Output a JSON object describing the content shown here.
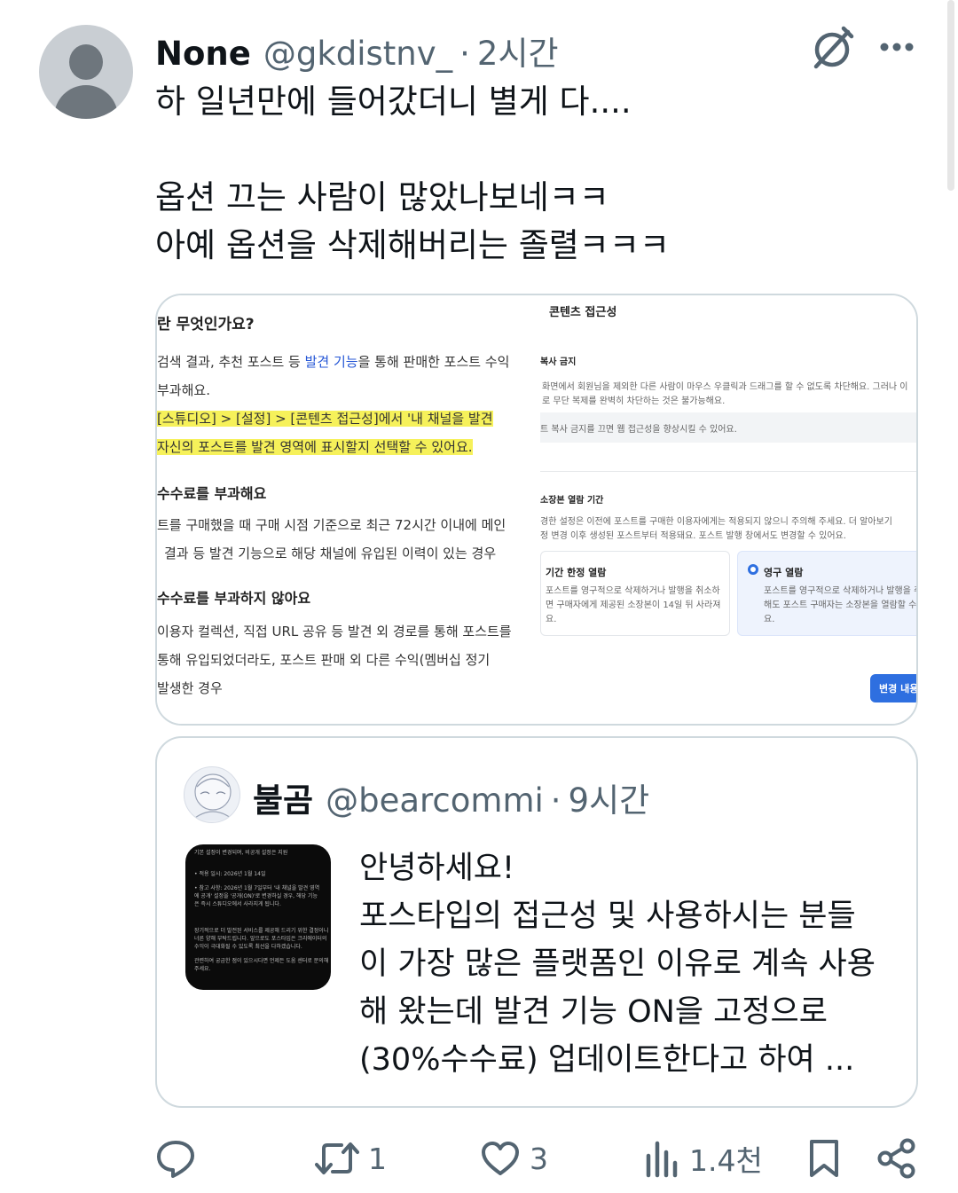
{
  "tweet": {
    "author_name": "None",
    "handle": "@gkdistnv_",
    "separator": "·",
    "time": "2시간",
    "text_lines": [
      "하 일년만에 들어갔더니 별게 다....",
      "",
      "옵션 끄는 사람이 많았나보네ㅋㅋ",
      "아예 옵션을 삭제해버리는 졸렬ㅋㅋㅋ"
    ]
  },
  "media": {
    "left_doc": {
      "heading1": "란 무엇인가요?",
      "line1_pre": "검색 결과, 추천 포스트 등 ",
      "line1_link": "발견 기능",
      "line1_post": "을 통해 판매한 포스트 수익",
      "line2": "부과해요.",
      "line3": "[스튜디오] > [설정] > [콘텐츠 접근성]에서 '내 채널을 발견",
      "line4": "자신의 포스트를 발견 영역에 표시할지 선택할 수 있어요.",
      "heading2": "수수료를 부과해요",
      "line5": "트를 구매했을 때 구매 시점 기준으로 최근 72시간 이내에 메인",
      "line6": "결과 등 발견 기능으로 해당 채널에 유입된 이력이 있는 경우",
      "heading3": "수수료를 부과하지 않아요",
      "line7": "이용자 컬렉션, 직접 URL 공유 등 발견 외 경로를 통해 포스트를",
      "line8": "통해 유입되었더라도, 포스트 판매 외 다른 수익(멤버십 정기",
      "line9": "발생한 경우"
    },
    "right_doc": {
      "title": "콘텐츠 접근성",
      "sec1_label": "복사 금지",
      "sec1_desc1": "화면에서 회원님을 제외한 다른 사람이 마우스 우클릭과 드래그를 할 수 없도록 차단해요. 그러나 이",
      "sec1_desc2": "로 무단 복제를 완벽히 차단하는 것은 불가능해요.",
      "sec1_note": "트 복사 금지를 끄면 웹 접근성을 향상시킬 수 있어요.",
      "sec2_label": "소장본 열람 기간",
      "sec2_desc1": "경한 설정은 이전에 포스트를 구매한 이용자에게는 적용되지 않으니 주의해 주세요. 더 알아보기",
      "sec2_desc2": "정 변경 이후 생성된 포스트부터 적용돼요. 포스트 발행 창에서도 변경할 수 있어요.",
      "option1_title": "기간 한정 열람",
      "option1_desc1": "포스트를 영구적으로 삭제하거나 발행을 취소하",
      "option1_desc2": "면 구매자에게 제공된 소장본이 14일 뒤 사라져",
      "option1_desc3": "요.",
      "option2_title": "영구 열람",
      "option2_desc1": "포스트를 영구적으로 삭제하거나 발행을 취",
      "option2_desc2": "해도 포스트 구매자는 소장본을 열람할 수",
      "option2_desc3": "요.",
      "save_button": "변경 내용 저"
    }
  },
  "quote": {
    "author_name": "불곰",
    "handle": "@bearcommi",
    "separator": "·",
    "time": "9시간",
    "text_lines": [
      "안녕하세요!",
      "포스타입의 접근성 및 사용하시는 분들",
      "이 가장 많은 플랫폼인 이유로 계속 사용",
      "해 왔는데 발견 기능 ON을 고정으로",
      "(30%수수료) 업데이트한다고 하여 ..."
    ],
    "thumbnail_lines": [
      "기본 설정이 변경되며, 비공개 설정은 지원",
      "• 적용 일시: 2026년 1월 14일",
      "• 참고 사항: 2026년 1월 7일부터 '내 채널을 발견 영역",
      "에 공개' 설정을 '공개(ON)'로 변경하실 경우, 해당 기능",
      "은 즉시 스튜디오에서 사라지게 됩니다.",
      "장기적으로 더 발전된 서비스를 제공해 드리기 위한 결정이니",
      "너른 양해 부탁드립니다. 앞으로도 포스타입은 크리에이터의",
      "수익이 극대화될 수 있도록 최선을 다하겠습니다.",
      "관련하여 궁금한 점이 있으시다면 언제든 도움 센터로 문의해",
      "주세요."
    ]
  },
  "actions": {
    "reply_count": "",
    "retweet_count": "1",
    "like_count": "3",
    "views_count": "1.4천"
  },
  "colors": {
    "text_primary": "#0f1419",
    "text_secondary": "#536471",
    "border": "#cfd9de",
    "highlight": "#f6f15a",
    "link_blue": "#2456d6",
    "button_blue": "#2e6fe0"
  }
}
